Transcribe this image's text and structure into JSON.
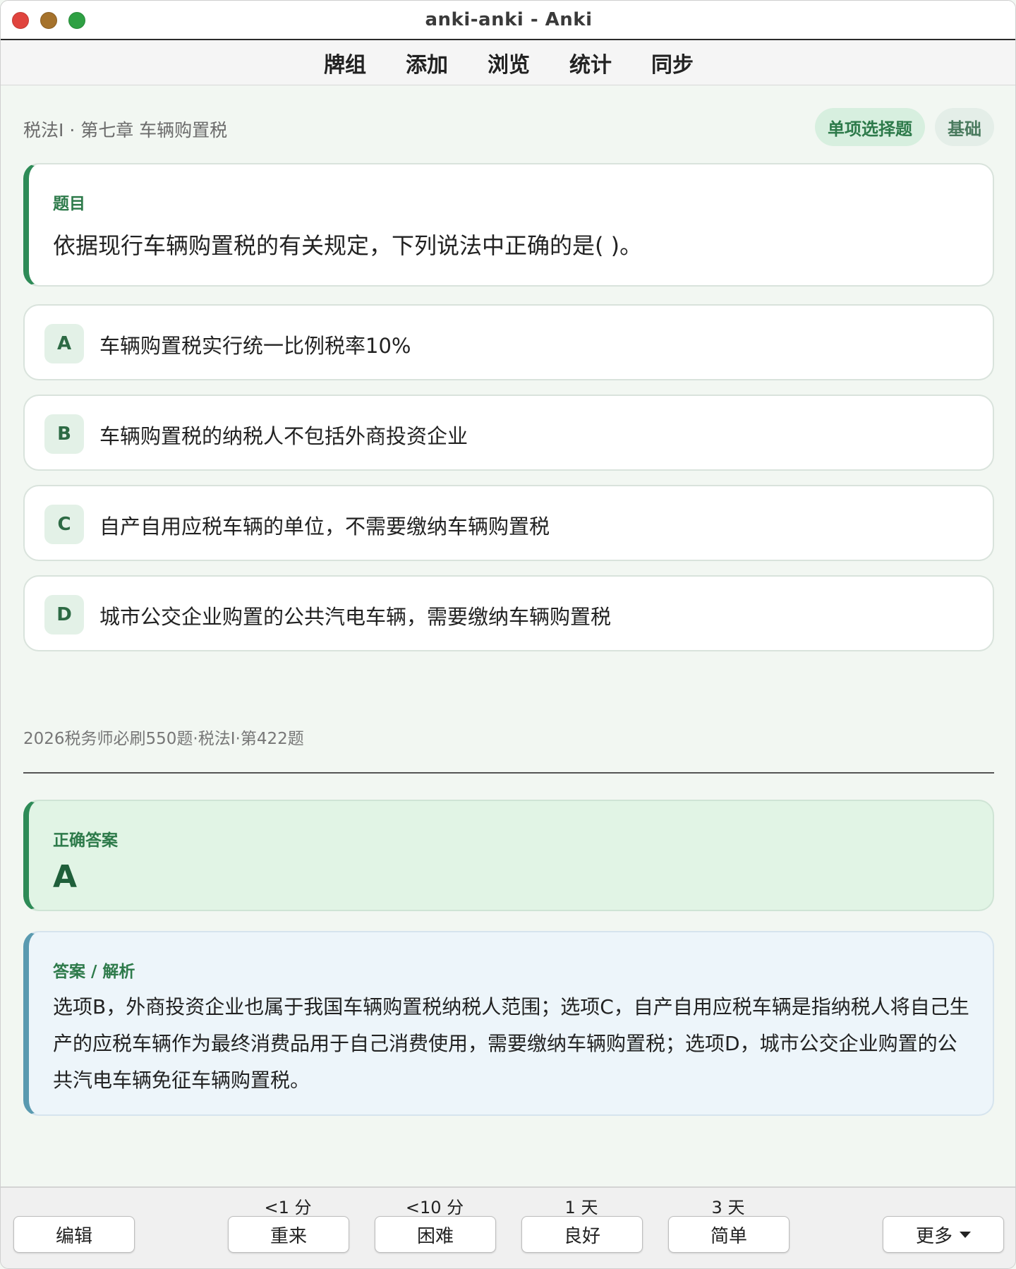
{
  "window": {
    "title": "anki-anki - Anki"
  },
  "toolbar": {
    "items": [
      "牌组",
      "添加",
      "浏览",
      "统计",
      "同步"
    ]
  },
  "card": {
    "breadcrumb": "税法I · 第七章 车辆购置税",
    "tags": {
      "type": "单项选择题",
      "level": "基础"
    },
    "question": {
      "label": "题目",
      "text": "依据现行车辆购置税的有关规定，下列说法中正确的是( )。"
    },
    "options": [
      {
        "letter": "A",
        "text": "车辆购置税实行统一比例税率10%"
      },
      {
        "letter": "B",
        "text": "车辆购置税的纳税人不包括外商投资企业"
      },
      {
        "letter": "C",
        "text": "自产自用应税车辆的单位，不需要缴纳车辆购置税"
      },
      {
        "letter": "D",
        "text": "城市公交企业购置的公共汽电车辆，需要缴纳车辆购置税"
      }
    ],
    "source": "2026税务师必刷550题·税法I·第422题",
    "answer": {
      "label": "正确答案",
      "value": "A"
    },
    "analysis": {
      "label": "答案 / 解析",
      "text": "选项B，外商投资企业也属于我国车辆购置税纳税人范围；选项C，自产自用应税车辆是指纳税人将自己生产的应税车辆作为最终消费品用于自己消费使用，需要缴纳车辆购置税；选项D，城市公交企业购置的公共汽电车辆免征车辆购置税。"
    }
  },
  "bottom": {
    "edit_label": "编辑",
    "more_label": "更多",
    "answers": [
      {
        "interval": "<1 分",
        "label": "重来"
      },
      {
        "interval": "<10 分",
        "label": "困难"
      },
      {
        "interval": "1 天",
        "label": "良好"
      },
      {
        "interval": "3 天",
        "label": "简单"
      }
    ]
  }
}
